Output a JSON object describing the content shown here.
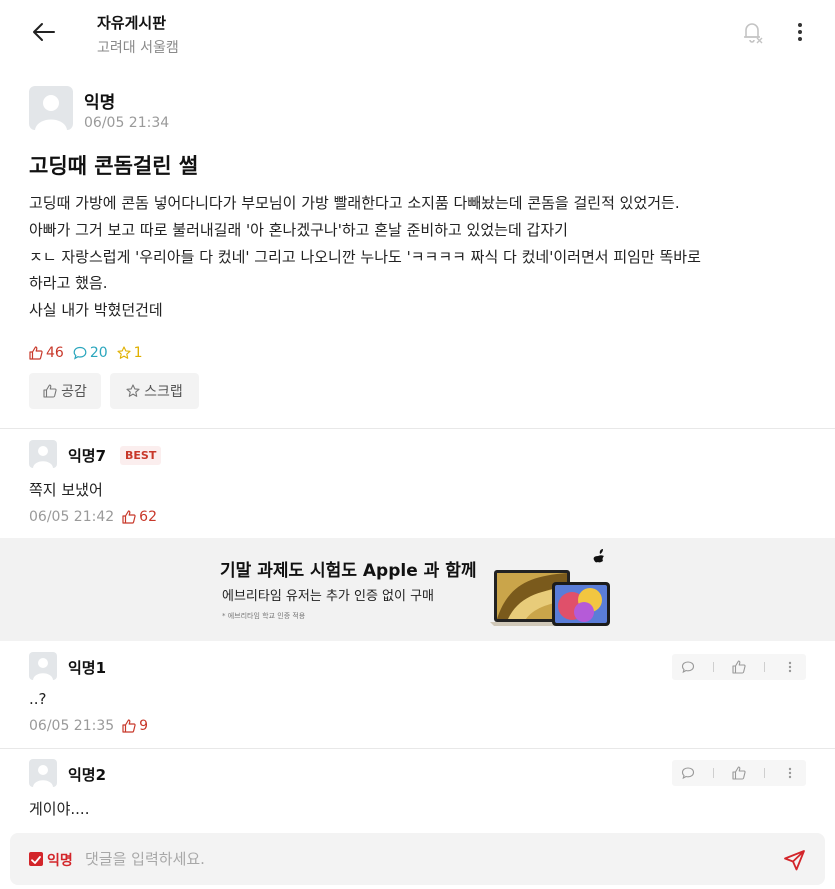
{
  "header": {
    "board_title": "자유게시판",
    "board_subtitle": "고려대 서울캠",
    "icons": {
      "back": "arrow-left-icon",
      "notify": "bell-off-icon",
      "more": "more-vertical-icon"
    }
  },
  "post": {
    "author": "익명",
    "time": "06/05 21:34",
    "title": "고딩때 콘돔걸린 썰",
    "body": "고딩때 가방에 콘돔 넣어다니다가 부모님이 가방 빨래한다고 소지품 다빼놨는데 콘돔을 걸린적 있었거든.\n아빠가 그거 보고 따로 불러내길래 '아 혼나겠구나'하고 혼날 준비하고 있었는데 갑자기\nㅈㄴ 자랑스럽게 '우리아들 다 컸네' 그리고 나오니깐 누나도 'ㅋㅋㅋㅋ 짜식 다 컸네'이러면서 피임만 똑바로\n하라고 했음.\n사실 내가 박혔던건데",
    "stats": {
      "likes": "46",
      "comments": "20",
      "scraps": "1"
    },
    "actions": {
      "like_label": "공감",
      "scrap_label": "스크랩"
    }
  },
  "comments": [
    {
      "author": "익명7",
      "badge": "BEST",
      "body": "쪽지 보냈어",
      "time": "06/05 21:42",
      "likes": "62"
    },
    {
      "author": "익명1",
      "body": "..?",
      "time": "06/05 21:35",
      "likes": "9"
    },
    {
      "author": "익명2",
      "body": "게이야...."
    }
  ],
  "ad": {
    "title": "기말 과제도 시험도 Apple 과 함께",
    "subtitle": "에브리타임 유저는 추가 인증 없이 구매",
    "note": "* 에브리타임 학교 인증 적용"
  },
  "composer": {
    "anon_label": "익명",
    "placeholder": "댓글을 입력하세요."
  },
  "colors": {
    "accent": "#c8382a",
    "comment_stat": "#2ba6bd",
    "scrap_stat": "#e0b000",
    "composer_red": "#d3252a"
  }
}
